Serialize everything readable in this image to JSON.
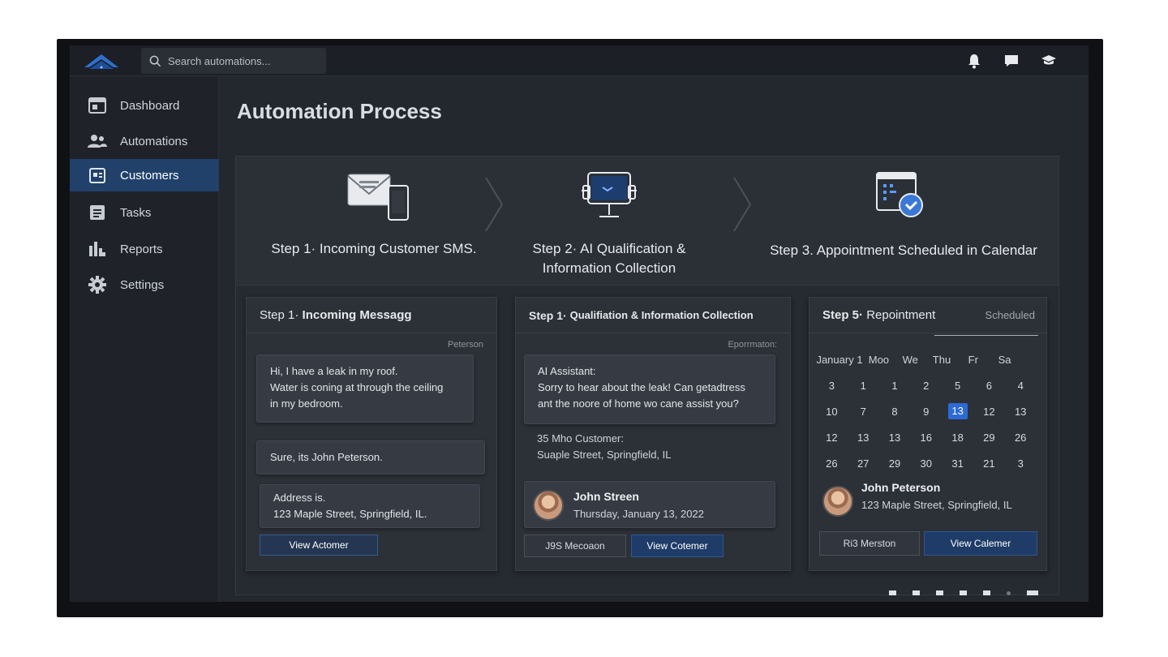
{
  "search": {
    "placeholder": "Search automations..."
  },
  "sidebar": {
    "items": [
      {
        "label": "Dashboard",
        "icon": "dashboard-icon"
      },
      {
        "label": "Automations",
        "icon": "users-icon"
      },
      {
        "label": "Customers",
        "icon": "customers-icon",
        "active": true
      },
      {
        "label": "Tasks",
        "icon": "tasks-icon"
      },
      {
        "label": "Reports",
        "icon": "reports-icon"
      },
      {
        "label": "Settings",
        "icon": "gear-icon"
      }
    ]
  },
  "page": {
    "title": "Automation Process"
  },
  "steps": [
    {
      "label": "Step 1· Incoming Customer SMS.",
      "icon": "sms-envelope-phone-icon"
    },
    {
      "label": "Step 2· AI Qualification &",
      "label2": "Information Collection",
      "icon": "ai-monitor-icon"
    },
    {
      "label": "Step 3. Appointment Scheduled in Calendar",
      "icon": "calendar-check-icon"
    }
  ],
  "card1": {
    "title_prefix": "Step 1·",
    "title_bold": "Incoming Messagg",
    "sender": "Peterson",
    "message1": [
      "Hi, I have a leak in my roof.",
      "Water is coning at through the ceiling",
      "in my bedroom."
    ],
    "message2": "Sure, its John Peterson.",
    "message3": [
      "Address is.",
      "123 Maple Street, Springfield, IL."
    ],
    "button": "View Actomer"
  },
  "card2": {
    "title_prefix": "Step 1·",
    "title_bold": "Qualifiation & Information Collection",
    "sender": "Eporrmaton:",
    "assistant": [
      "AI Assistant:",
      "Sorry to hear about the leak! Can getadtress",
      "ant the noore of home wo cane assist you?"
    ],
    "customer": [
      "35 Mho Customer:",
      "Suaple Street, Springfield, IL"
    ],
    "person_name": "John Streen",
    "person_date": "Thursday, January 13, 2022",
    "button_secondary": "J9S Mecoaon",
    "button_primary": "View Cotemer"
  },
  "card3": {
    "title_prefix": "Step 5·",
    "title": "Repointment",
    "status": "Scheduled",
    "calendar_header": [
      "January 1",
      "Moo",
      "We",
      "Thu",
      "Fr",
      "Sa"
    ],
    "calendar_rows": [
      [
        "3",
        "1",
        "1",
        "2",
        "5",
        "6",
        "4"
      ],
      [
        "10",
        "7",
        "8",
        "9",
        "13",
        "12",
        "13"
      ],
      [
        "12",
        "13",
        "13",
        "16",
        "18",
        "29",
        "26"
      ],
      [
        "26",
        "27",
        "29",
        "30",
        "31",
        "21",
        "3"
      ]
    ],
    "selected_day": "13",
    "person_name": "John Peterson",
    "person_address": "123 Maple Street, Springfield, IL",
    "button_secondary": "Ri3 Merston",
    "button_primary": "View Calemer"
  },
  "colors": {
    "accent": "#2d6ad6",
    "sidebar_active": "#21416b",
    "primary_button": "#1f3c68"
  }
}
